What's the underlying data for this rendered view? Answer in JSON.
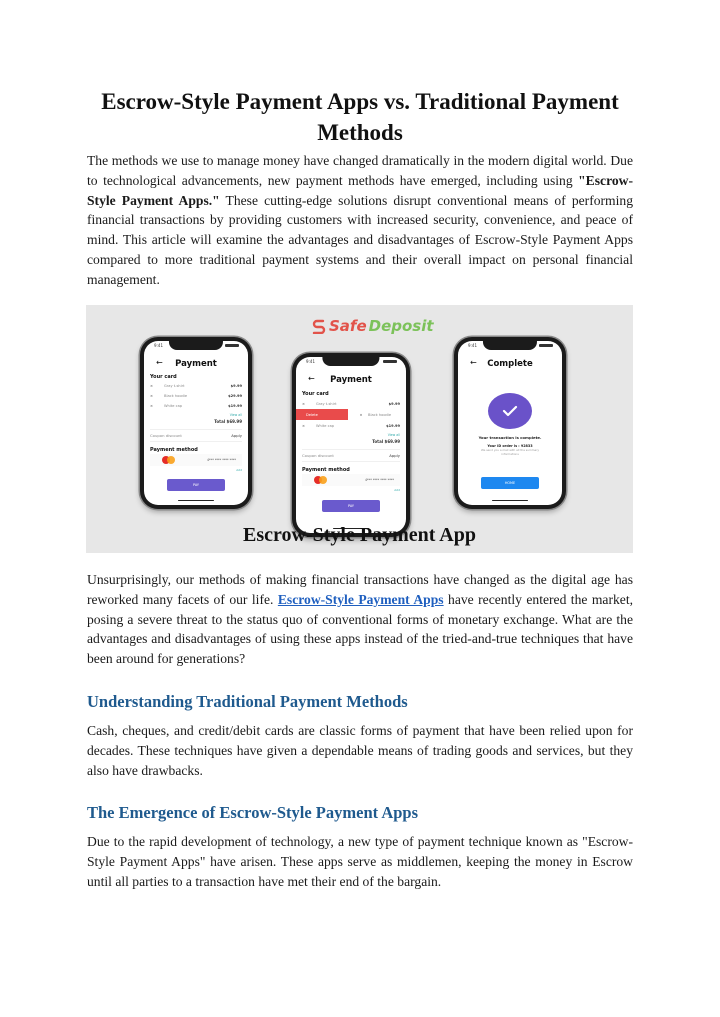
{
  "article": {
    "title": "Escrow-Style Payment Apps vs. Traditional Payment Methods",
    "intro": {
      "before_bold": "The methods we use to manage money have changed dramatically in the modern digital world. Due to technological advancements, new payment methods have emerged, including using ",
      "bold": "\"Escrow-Style Payment Apps.\"",
      "after_bold": " These cutting-edge solutions disrupt conventional means of performing financial transactions by providing customers with increased security, convenience, and peace of mind. This article will examine the advantages and disadvantages of Escrow-Style Payment Apps compared to more traditional payment systems and their overall impact on personal financial management."
    },
    "paragraph2": {
      "before_link": "Unsurprisingly, our methods of making financial transactions have changed as the digital age has reworked many facets of our life. ",
      "link_text": "Escrow-Style Payment Apps",
      "after_link": " have recently entered the market, posing a severe threat to the status quo of conventional forms of monetary exchange. What are the advantages and disadvantages of using these apps instead of the tried-and-true techniques that have been around for generations?"
    },
    "sections": [
      {
        "heading": "Understanding Traditional Payment Methods",
        "body": "Cash, cheques, and credit/debit cards are classic forms of payment that have been relied upon for decades. These techniques have given a dependable means of trading goods and services, but they also have drawbacks."
      },
      {
        "heading": "The Emergence of Escrow-Style Payment Apps",
        "body": "Due to the rapid development of technology, a new type of payment technique known as \"Escrow-Style Payment Apps\" have arisen. These apps serve as middlemen, keeping the money in Escrow until all parties to a transaction have met their end of the bargain."
      }
    ],
    "colors": {
      "heading_blue": "#1f5a8e",
      "link_blue": "#1f5fbf"
    }
  },
  "hero_image": {
    "logo": {
      "safe": "Safe",
      "deposit": "Deposit",
      "safe_color": "#e2534a",
      "deposit_color": "#7cc25a"
    },
    "caption": "Escrow-Style Payment App",
    "phones": {
      "status_time": "9:41",
      "payment": {
        "title": "Payment",
        "your_card": "Your card",
        "items": [
          {
            "name": "Gray t-shirt",
            "price": "$9.99"
          },
          {
            "name": "Black hoodie",
            "price": "$29.99"
          },
          {
            "name": "White cap",
            "price": "$19.99"
          }
        ],
        "view_all": "View all",
        "total": "Total  $69.99",
        "coupon": "Coupon discount",
        "apply": "Apply",
        "payment_method": "Payment method",
        "card_number": "4*** **** **** ****",
        "add": "Add",
        "pay": "PAY",
        "delete": "Delete"
      },
      "complete": {
        "title": "Complete",
        "message": "Your transaction is complete.",
        "order": "Your ID order is : 92833",
        "note": "We send you a mail with all the summary informations",
        "home": "HOME"
      }
    }
  }
}
